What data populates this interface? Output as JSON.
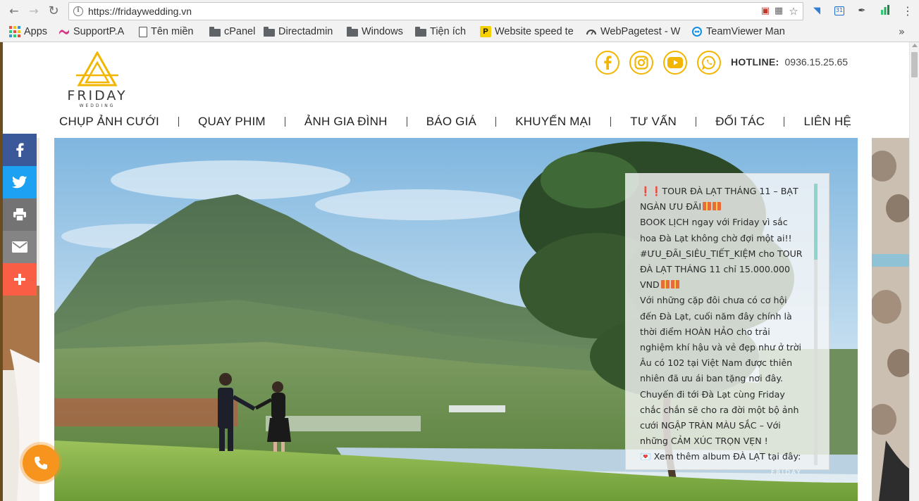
{
  "browser": {
    "url": "https://fridaywedding.vn",
    "bookmarks": [
      {
        "label": "Apps",
        "icon": "apps-icon"
      },
      {
        "label": "SupportP.A",
        "icon": "support-icon"
      },
      {
        "label": "Tên miền",
        "icon": "page-icon"
      },
      {
        "label": "cPanel",
        "icon": "folder-icon"
      },
      {
        "label": "Directadmin",
        "icon": "folder-icon"
      },
      {
        "label": "Windows",
        "icon": "folder-icon"
      },
      {
        "label": "Tiện ích",
        "icon": "folder-icon"
      },
      {
        "label": "Website speed te",
        "icon": "speed-icon"
      },
      {
        "label": "WebPagetest - W",
        "icon": "gauge-icon"
      },
      {
        "label": "TeamViewer Man",
        "icon": "teamviewer-icon"
      }
    ],
    "more": "»"
  },
  "site": {
    "logo_text": "FRIDAY",
    "logo_sub": "WEDDING",
    "brand_color": "#f2b600",
    "hotline_label": "HOTLINE:",
    "hotline_number": "0936.15.25.65",
    "nav": [
      {
        "label": "CHỤP ẢNH CƯỚI"
      },
      {
        "label": "QUAY PHIM"
      },
      {
        "label": "ẢNH GIA ĐÌNH"
      },
      {
        "label": "BÁO GIÁ"
      },
      {
        "label": "KHUYẾN MẠI"
      },
      {
        "label": "TƯ VẤN"
      },
      {
        "label": "ĐỐI TÁC"
      },
      {
        "label": "LIÊN HỆ"
      }
    ]
  },
  "news": {
    "title": "TOUR ĐÀ LẠT THÁNG 11 – BẠT NGÀN ƯU ĐÃI",
    "p1": "BOOK LỊCH ngay với Friday vì sắc hoa Đà Lạt không chờ đợi một ai!!",
    "p2": "#ƯU_ĐÃI_SIÊU_TIẾT_KIỆM cho TOUR ĐÀ LẠT THÁNG 11 chỉ 15.000.000 VND",
    "p3": "Với những cặp đôi chưa có cơ hội đến Đà Lạt, cuối năm đây chính là thời điểm HOÀN HẢO cho trải nghiệm khí hậu và vẻ đẹp như ở trời Âu có 102 tại Việt Nam được thiên nhiên đã ưu ái ban tặng nơi đây.",
    "p4": "Chuyến đi tới Đà Lạt cùng Friday chắc chắn sẽ cho ra đời một bộ ảnh cưới NGẬP TRÀN MÀU SẮC – Với những CẢM XÚC TRỌN VẸN !",
    "p5": "Xem thêm album ĐÀ LẠT tại đây:",
    "watermark": "FRIDAY"
  },
  "share": {
    "colors": {
      "facebook": "#3b5998",
      "twitter": "#1da1f2",
      "print": "#737373",
      "email": "#848484",
      "more": "#fa5e45"
    }
  }
}
